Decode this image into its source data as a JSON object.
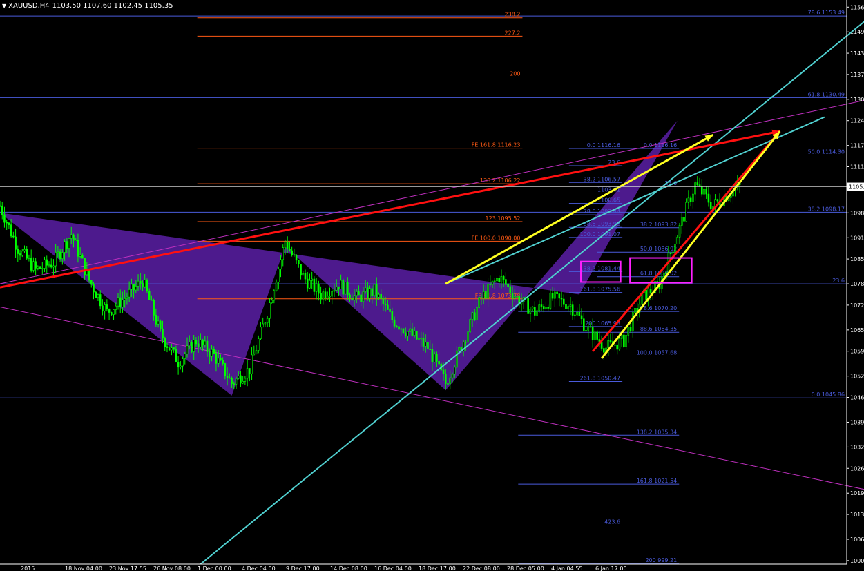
{
  "header": {
    "symbol": "XAUUSD,H4",
    "ohlc": "1103.50 1107.60 1102.45 1105.35"
  },
  "colors": {
    "background": "#000000",
    "axis": "#ffffff",
    "candle_up": "#00ff00",
    "candle_down": "#00ff00",
    "pattern_fill": "#5b1fa6",
    "fib_retrace": "#4a5bdc",
    "fib_extension": "#ff5a14",
    "trend_magenta": "#c030c0",
    "channel_cyan": "#50d0d0",
    "arrow_red": "#ff1010",
    "arrow_yellow": "#ffff20",
    "price_line": "#ffffff",
    "highlight_box": "#ff20ff"
  },
  "chart_data": {
    "type": "candlestick",
    "symbol": "XAUUSD",
    "timeframe": "H4",
    "current_price": "1105.35",
    "ylim": [
      999.0,
      1158.0
    ],
    "y_ticks": [
      "1156.",
      "1149.",
      "1143.",
      "1137.",
      "1130.",
      "1124.",
      "1117.",
      "1111.",
      "1105.",
      "1098.",
      "1091.",
      "1085.",
      "1078.",
      "1072.",
      "1065.",
      "1059.",
      "1052.",
      "1046.",
      "1039.",
      "1032.",
      "1026.",
      "1019.",
      "1013.",
      "1006.",
      "1000."
    ],
    "x_ticks": [
      "2015",
      "18 Nov 04:00",
      "23 Nov 17:55",
      "26 Nov 08:00",
      "1 Dec 00:00",
      "4 Dec 04:00",
      "9 Dec 17:00",
      "14 Dec 08:00",
      "16 Dec 04:00",
      "18 Dec 17:00",
      "22 Dec 08:00",
      "28 Dec 05:00",
      "4 Jan 04:55",
      "6 Jan 17:00"
    ],
    "price_path": [
      [
        0,
        1100
      ],
      [
        4,
        1088
      ],
      [
        8,
        1082
      ],
      [
        12,
        1084
      ],
      [
        16,
        1092
      ],
      [
        20,
        1079
      ],
      [
        24,
        1070
      ],
      [
        28,
        1074
      ],
      [
        32,
        1079
      ],
      [
        36,
        1064
      ],
      [
        40,
        1056
      ],
      [
        44,
        1062
      ],
      [
        48,
        1058
      ],
      [
        52,
        1050
      ],
      [
        56,
        1054
      ],
      [
        60,
        1070
      ],
      [
        64,
        1090
      ],
      [
        68,
        1080
      ],
      [
        72,
        1075
      ],
      [
        76,
        1078
      ],
      [
        80,
        1074
      ],
      [
        84,
        1076
      ],
      [
        88,
        1068
      ],
      [
        92,
        1064
      ],
      [
        96,
        1060
      ],
      [
        100,
        1050
      ],
      [
        104,
        1062
      ],
      [
        108,
        1074
      ],
      [
        112,
        1080
      ],
      [
        116,
        1074
      ],
      [
        120,
        1070
      ],
      [
        124,
        1074
      ],
      [
        128,
        1072
      ],
      [
        132,
        1065
      ],
      [
        136,
        1060
      ],
      [
        140,
        1062
      ],
      [
        144,
        1074
      ],
      [
        148,
        1078
      ],
      [
        152,
        1092
      ],
      [
        156,
        1106
      ],
      [
        160,
        1100
      ],
      [
        164,
        1104
      ],
      [
        166,
        1105.35
      ]
    ],
    "fib_levels": [
      {
        "label": "78.6 1153.49",
        "price": 1153.49,
        "color": "blue",
        "x1": 0,
        "x2": 1.0,
        "label_align": "right"
      },
      {
        "label": "61.8 1130.49",
        "price": 1130.49,
        "color": "blue",
        "x1": 0,
        "x2": 1.0,
        "label_align": "right"
      },
      {
        "label": "50.0 1114.30",
        "price": 1114.3,
        "color": "blue",
        "x1": 0,
        "x2": 1.0,
        "label_align": "right"
      },
      {
        "label": "38.2 1098.17",
        "price": 1098.17,
        "color": "blue",
        "x1": 0,
        "x2": 1.0,
        "label_align": "right"
      },
      {
        "label": "23.6",
        "price": 1078.0,
        "color": "blue",
        "x1": 0,
        "x2": 1.0,
        "label_align": "right"
      },
      {
        "label": "0.0 1045.86",
        "price": 1045.86,
        "color": "blue",
        "x1": 0,
        "x2": 1.0,
        "label_align": "right"
      },
      {
        "label": "238.2",
        "price": 1153.0,
        "color": "orange",
        "x1": 0.233,
        "x2": 0.617,
        "label_align": "right"
      },
      {
        "label": "227.2",
        "price": 1147.8,
        "color": "orange",
        "x1": 0.233,
        "x2": 0.617,
        "label_align": "right"
      },
      {
        "label": "200",
        "price": 1136.3,
        "color": "orange",
        "x1": 0.233,
        "x2": 0.617,
        "label_align": "right"
      },
      {
        "label": "FE 161.8 1116.23",
        "price": 1116.23,
        "color": "orange",
        "x1": 0.233,
        "x2": 0.617,
        "label_align": "right"
      },
      {
        "label": "138.2 1106.22",
        "price": 1106.22,
        "color": "orange",
        "x1": 0.233,
        "x2": 0.617,
        "label_align": "right"
      },
      {
        "label": "123 1095.52",
        "price": 1095.52,
        "color": "orange",
        "x1": 0.233,
        "x2": 0.617,
        "label_align": "right"
      },
      {
        "label": "FE 100.0 1090.00",
        "price": 1090.0,
        "color": "orange",
        "x1": 0.233,
        "x2": 0.617,
        "label_align": "right"
      },
      {
        "label": "FE 61.8 1073.78",
        "price": 1073.78,
        "color": "orange",
        "x1": 0.233,
        "x2": 0.617,
        "label_align": "right"
      },
      {
        "label": "0.0 1116.16",
        "price": 1116.16,
        "color": "blue",
        "x1": 0.672,
        "x2": 0.735,
        "label_align": "right"
      },
      {
        "label": "23.6",
        "price": 1111.3,
        "color": "blue",
        "x1": 0.672,
        "x2": 0.735,
        "label_align": "right"
      },
      {
        "label": "38.2 1106.57",
        "price": 1106.57,
        "color": "blue",
        "x1": 0.672,
        "x2": 0.735,
        "label_align": "right"
      },
      {
        "label": "1103.61",
        "price": 1103.61,
        "color": "blue",
        "x1": 0.672,
        "x2": 0.735,
        "label_align": "right"
      },
      {
        "label": "1100.65",
        "price": 1100.65,
        "color": "blue",
        "x1": 0.672,
        "x2": 0.735,
        "label_align": "right"
      },
      {
        "label": "78.6 1097.44",
        "price": 1097.44,
        "color": "blue",
        "x1": 0.672,
        "x2": 0.735,
        "label_align": "right"
      },
      {
        "label": "88.6 1093.93",
        "price": 1093.93,
        "color": "blue",
        "x1": 0.672,
        "x2": 0.735,
        "label_align": "right"
      },
      {
        "label": "100.0 1091.07",
        "price": 1091.07,
        "color": "blue",
        "x1": 0.672,
        "x2": 0.735,
        "label_align": "right"
      },
      {
        "label": "138.2 1081.44",
        "price": 1081.44,
        "color": "blue",
        "x1": 0.672,
        "x2": 0.735,
        "label_align": "right"
      },
      {
        "label": "161.8 1075.56",
        "price": 1075.56,
        "color": "blue",
        "x1": 0.672,
        "x2": 0.735,
        "label_align": "right"
      },
      {
        "label": "200 1065.98",
        "price": 1065.98,
        "color": "blue",
        "x1": 0.672,
        "x2": 0.735,
        "label_align": "right"
      },
      {
        "label": "261.8 1050.47",
        "price": 1050.47,
        "color": "blue",
        "x1": 0.672,
        "x2": 0.735,
        "label_align": "right"
      },
      {
        "label": "423.6",
        "price": 1010.0,
        "color": "blue",
        "x1": 0.672,
        "x2": 0.735,
        "label_align": "right"
      },
      {
        "label": "0.0 1116.16",
        "price": 1116.16,
        "color": "blue",
        "x1": 0.705,
        "x2": 0.802,
        "label_align": "right"
      },
      {
        "label": "23.6",
        "price": 1105.5,
        "color": "blue",
        "x1": 0.705,
        "x2": 0.802,
        "label_align": "right"
      },
      {
        "label": "38.2 1093.82",
        "price": 1093.82,
        "color": "blue",
        "x1": 0.705,
        "x2": 0.802,
        "label_align": "right"
      },
      {
        "label": "50.0 1086.92",
        "price": 1086.92,
        "color": "blue",
        "x1": 0.705,
        "x2": 0.802,
        "label_align": "right"
      },
      {
        "label": "61.8 1080.02",
        "price": 1080.02,
        "color": "blue",
        "x1": 0.705,
        "x2": 0.802,
        "label_align": "right"
      },
      {
        "label": "78.6 1070.20",
        "price": 1070.2,
        "color": "blue",
        "x1": 0.612,
        "x2": 0.802,
        "label_align": "right"
      },
      {
        "label": "88.6 1064.35",
        "price": 1064.35,
        "color": "blue",
        "x1": 0.612,
        "x2": 0.802,
        "label_align": "right"
      },
      {
        "label": "100.0 1057.68",
        "price": 1057.68,
        "color": "blue",
        "x1": 0.612,
        "x2": 0.802,
        "label_align": "right"
      },
      {
        "label": "138.2 1035.34",
        "price": 1035.34,
        "color": "blue",
        "x1": 0.612,
        "x2": 0.802,
        "label_align": "right"
      },
      {
        "label": "161.8 1021.54",
        "price": 1021.54,
        "color": "blue",
        "x1": 0.612,
        "x2": 0.802,
        "label_align": "right"
      },
      {
        "label": "200 999.21",
        "price": 999.21,
        "color": "blue",
        "x1": 0.612,
        "x2": 0.802,
        "label_align": "right"
      }
    ],
    "patterns": [
      {
        "name": "pattern-left",
        "points": [
          [
            0,
            1098.0
          ],
          [
            52,
            1046.5
          ],
          [
            64,
            1088.5
          ],
          [
            100,
            1048.0
          ],
          [
            152,
            1124.0
          ],
          [
            130,
            1075.0
          ]
        ]
      }
    ],
    "trend_lines": [
      {
        "type": "magenta",
        "p1": [
          0,
          1071.5
        ],
        "p2": [
          230,
          1010.5
        ]
      },
      {
        "type": "magenta",
        "p1": [
          0,
          1078.0
        ],
        "p2": [
          210,
          1134.0
        ]
      }
    ],
    "arrows": [
      {
        "color": "red",
        "p1": [
          0,
          1077.0
        ],
        "p2": [
          175,
          1121.0
        ]
      },
      {
        "color": "red",
        "p1": [
          133,
          1059.0
        ],
        "p2": [
          175,
          1121.0
        ]
      },
      {
        "color": "yellow",
        "p1": [
          100,
          1078.0
        ],
        "p2": [
          160,
          1120.0
        ]
      },
      {
        "color": "yellow",
        "p1": [
          135,
          1057.0
        ],
        "p2": [
          175,
          1121.0
        ]
      }
    ],
    "highlight_boxes": [
      {
        "label": "138.2 1081.44",
        "price_top": 1084.3,
        "price_bottom": 1078.5
      },
      {
        "label": "61.8 1080.02",
        "price_top": 1085.3,
        "price_bottom": 1078.3
      }
    ],
    "grid": false,
    "legend": "none"
  }
}
